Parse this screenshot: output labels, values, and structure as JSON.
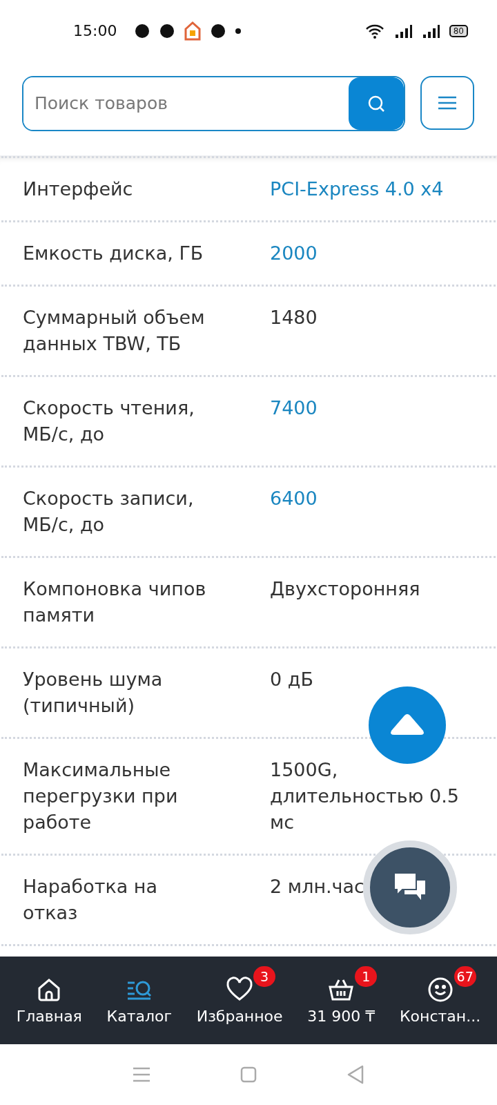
{
  "status_bar": {
    "time": "15:00",
    "battery": "80"
  },
  "search": {
    "placeholder": "Поиск товаров"
  },
  "specs": [
    {
      "label": "Интерфейс",
      "value": "PCI-Express 4.0 x4",
      "link": true
    },
    {
      "label": "Емкость диска, ГБ",
      "value": "2000",
      "link": true
    },
    {
      "label": "Суммарный объем данных TBW, ТБ",
      "value": "1480",
      "link": false
    },
    {
      "label": "Скорость чтения, МБ/с, до",
      "value": "7400",
      "link": true
    },
    {
      "label": "Скорость записи, МБ/с, до",
      "value": "6400",
      "link": true
    },
    {
      "label": "Компоновка чипов памяти",
      "value": "Двухсторонняя",
      "link": false
    },
    {
      "label": "Уровень шума (типичный)",
      "value": "0 дБ",
      "link": false
    },
    {
      "label": "Максимальные перегрузки при работе",
      "value": "1500G, длительностью 0.5 мс",
      "link": false
    },
    {
      "label": "Наработка на отказ",
      "value": "2 млн.час",
      "link": false
    }
  ],
  "bottom_nav": [
    {
      "kind": "home",
      "label": "Главная",
      "selected": false
    },
    {
      "kind": "catalog",
      "label": "Каталог",
      "selected": true
    },
    {
      "kind": "favorites",
      "label": "Избранное",
      "selected": false,
      "badge": "3"
    },
    {
      "kind": "cart",
      "label": "31 900 ₸",
      "selected": false,
      "badge": "1"
    },
    {
      "kind": "profile",
      "label": "Констан...",
      "selected": false,
      "badge": "67"
    }
  ]
}
